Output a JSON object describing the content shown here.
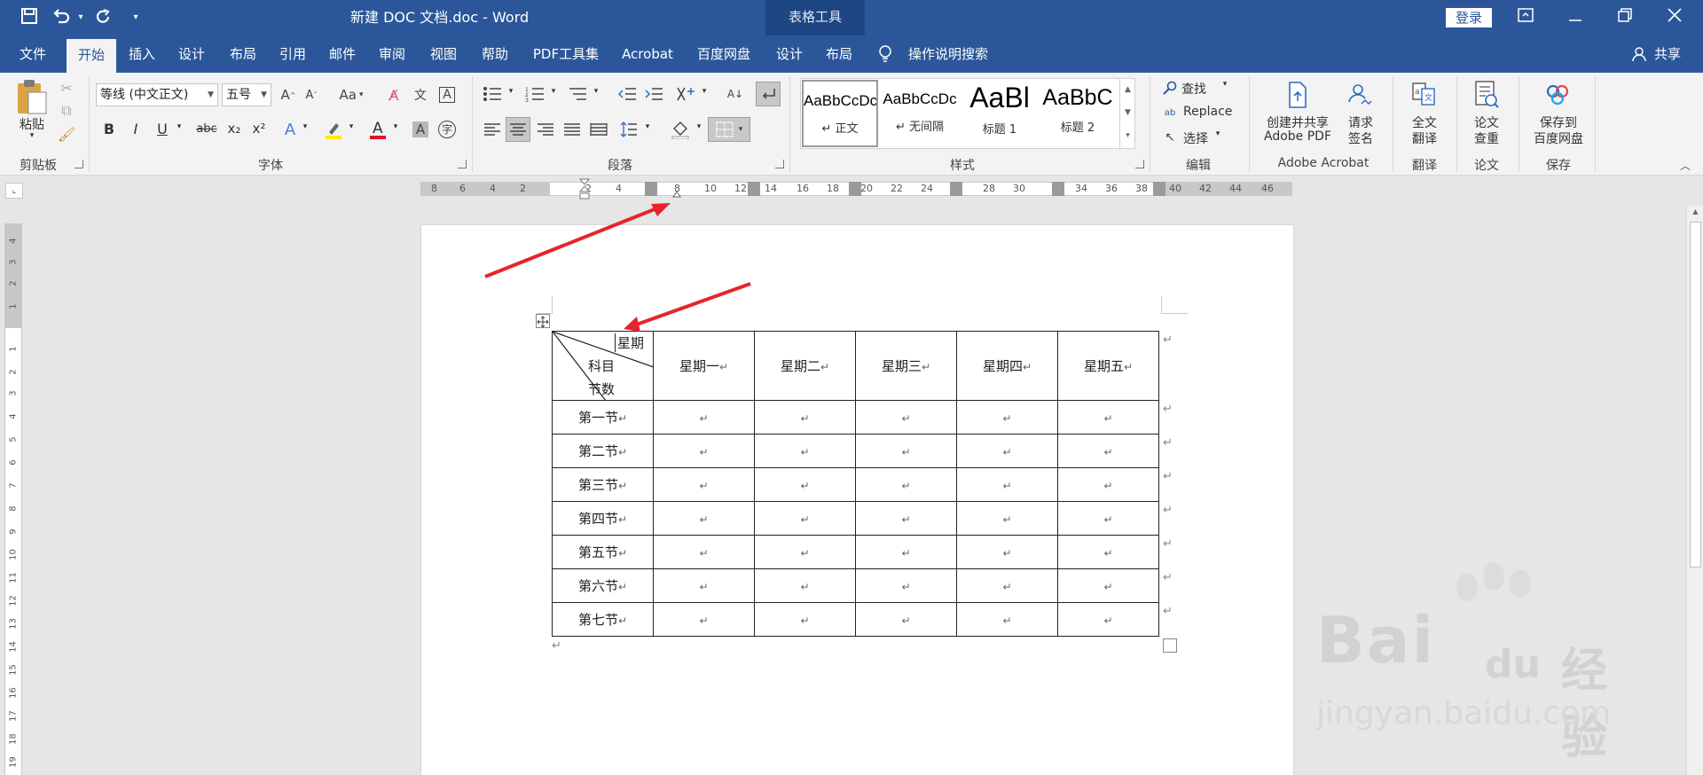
{
  "window": {
    "title": "新建 DOC 文档.doc  -  Word",
    "context_tool": "表格工具",
    "login": "登录"
  },
  "quick_access": {
    "save_icon": "save-icon",
    "undo_icon": "undo-icon",
    "redo_icon": "redo-icon",
    "customize": "▾"
  },
  "tabs": [
    "文件",
    "开始",
    "插入",
    "设计",
    "布局",
    "引用",
    "邮件",
    "审阅",
    "视图",
    "帮助",
    "PDF工具集",
    "Acrobat",
    "百度网盘",
    "设计",
    "布局"
  ],
  "active_tab": "开始",
  "search": "操作说明搜索",
  "share": "共享",
  "ribbon": {
    "clipboard": {
      "paste": "粘贴",
      "group": "剪贴板"
    },
    "font": {
      "font_name": "等线 (中文正文)",
      "font_size": "五号",
      "aa_label": "Aa",
      "bold": "B",
      "italic": "I",
      "underline": "U",
      "strike": "abc",
      "sub": "x₂",
      "sup": "x²",
      "group": "字体"
    },
    "paragraph": {
      "group": "段落"
    },
    "styles": {
      "tiles": [
        {
          "preview": "AaBbCcDc",
          "name": "↵ 正文"
        },
        {
          "preview": "AaBbCcDc",
          "name": "↵ 无间隔"
        },
        {
          "preview": "AaBl",
          "name": "标题 1"
        },
        {
          "preview": "AaBbC",
          "name": "标题 2"
        }
      ],
      "group": "样式"
    },
    "editing": {
      "find": "查找",
      "replace": "Replace",
      "select": "选择",
      "group": "编辑"
    },
    "acrobat": {
      "create": "创建并共享",
      "create2": "Adobe PDF",
      "sign": "请求",
      "sign2": "签名",
      "group": "Adobe Acrobat"
    },
    "translate": {
      "label": "全文",
      "label2": "翻译",
      "group": "翻译"
    },
    "thesis": {
      "label": "论文",
      "label2": "查重",
      "group": "论文"
    },
    "save": {
      "label": "保存到",
      "label2": "百度网盘",
      "group": "保存"
    }
  },
  "ruler": {
    "h_numbers": [
      "8",
      "6",
      "4",
      "2",
      "",
      "2",
      "4",
      "",
      "8",
      "10",
      "12",
      "14",
      "16",
      "18",
      "20",
      "22",
      "24",
      "",
      "28",
      "30",
      "",
      "34",
      "36",
      "38",
      "40",
      "42",
      "44",
      "46"
    ],
    "v_numbers": [
      "4",
      "3",
      "2",
      "1",
      "",
      "1",
      "2",
      "3",
      "4",
      "5",
      "6",
      "7",
      "8",
      "9",
      "10",
      "11",
      "12",
      "13",
      "14",
      "15",
      "16",
      "17",
      "18",
      "19"
    ]
  },
  "table": {
    "header_corner": {
      "top": "星期",
      "mid": "科目",
      "bottom": "节数"
    },
    "days": [
      "星期一",
      "星期二",
      "星期三",
      "星期四",
      "星期五"
    ],
    "rows": [
      "第一节",
      "第二节",
      "第三节",
      "第四节",
      "第五节",
      "第六节",
      "第七节"
    ],
    "mark": "↵"
  },
  "watermark": {
    "brand": "Bai",
    "cn": "经验",
    "url": "jingyan.baidu.com"
  }
}
